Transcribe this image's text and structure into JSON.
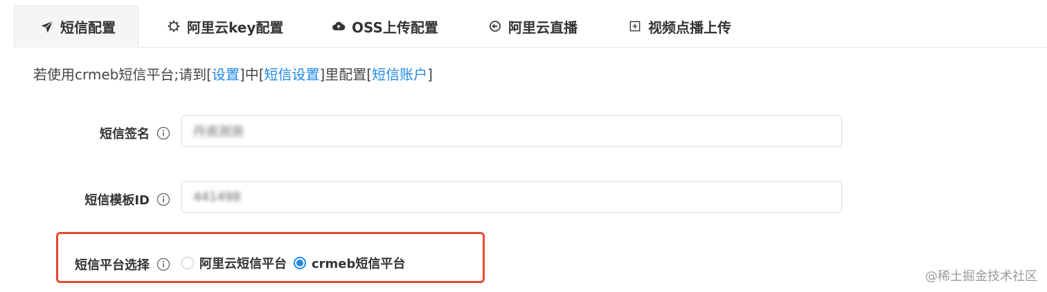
{
  "tabs": [
    {
      "label": "短信配置",
      "icon": "paper-plane-icon",
      "active": true
    },
    {
      "label": "阿里云key配置",
      "icon": "gear-icon",
      "active": false
    },
    {
      "label": "OSS上传配置",
      "icon": "cloud-upload-icon",
      "active": false
    },
    {
      "label": "阿里云直播",
      "icon": "circle-arrow-left-icon",
      "active": false
    },
    {
      "label": "视频点播上传",
      "icon": "plus-square-icon",
      "active": false
    }
  ],
  "notice": {
    "prefix": "若使用crmeb短信平台;请到[",
    "link1": "设置",
    "mid1": "]中[",
    "link2": "短信设置",
    "mid2": "]里配置[",
    "link3": "短信账户",
    "suffix": "]"
  },
  "form": {
    "sign_label": "短信签名",
    "sign_value": "丹资测测",
    "template_label": "短信模板ID",
    "template_value": "441498",
    "platform_label": "短信平台选择",
    "platform_options": [
      {
        "label": "阿里云短信平台",
        "checked": false
      },
      {
        "label": "crmeb短信平台",
        "checked": true
      }
    ]
  },
  "watermark": "@稀土掘金技术社区",
  "colors": {
    "accent": "#1e88e5",
    "highlight": "#e8492e"
  }
}
